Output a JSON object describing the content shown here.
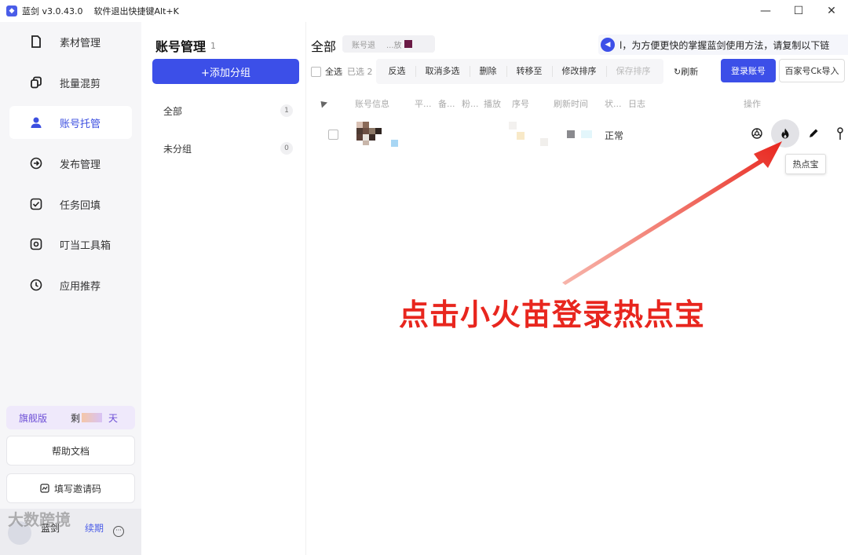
{
  "app": {
    "name": "蓝剑 v3.0.43.0",
    "shortcut": "软件退出快捷键Alt+K",
    "icon": "app-logo-icon"
  },
  "window": {
    "minimize": "—",
    "maximize": "☐",
    "close": "✕"
  },
  "sidebar": {
    "items": [
      {
        "label": "素材管理",
        "icon": "document-icon"
      },
      {
        "label": "批量混剪",
        "icon": "copy-icon"
      },
      {
        "label": "账号托管",
        "icon": "user-icon",
        "active": true
      },
      {
        "label": "发布管理",
        "icon": "publish-icon"
      },
      {
        "label": "任务回填",
        "icon": "task-check-icon"
      },
      {
        "label": "叮当工具箱",
        "icon": "toolbox-icon"
      },
      {
        "label": "应用推荐",
        "icon": "recommend-icon"
      }
    ],
    "vip": {
      "name": "旗舰版",
      "remain_prefix": "剩",
      "unit": "天"
    },
    "help": "帮助文档",
    "invite": "填写邀请码",
    "footer": {
      "name": "蓝剑",
      "link": "续期"
    }
  },
  "group_panel": {
    "title": "账号管理",
    "count": "1",
    "add_button": "+添加分组",
    "groups": [
      {
        "label": "全部",
        "count": "1"
      },
      {
        "label": "未分组",
        "count": "0"
      }
    ]
  },
  "main": {
    "title": "全部",
    "search_text": "账号退",
    "search_text_2": "...放",
    "notice": "l，为方便更快的掌握蓝剑使用方法，请复制以下链",
    "toolbar": {
      "select_all": "全选",
      "selected": "已选 2",
      "buttons": [
        "反选",
        "取消多选",
        "删除",
        "转移至",
        "修改排序",
        "保存排序"
      ],
      "refresh": "刷新",
      "login": "登录账号",
      "import": "百家号Ck导入"
    },
    "columns": [
      "账号信息",
      "平...",
      "备...",
      "粉...",
      "播放",
      "序号",
      "刷新时间",
      "状...",
      "日志",
      "操作"
    ],
    "row": {
      "status": "正常"
    },
    "tooltip": "热点宝"
  },
  "annotation": "点击小火苗登录热点宝",
  "watermark": "大数跨境",
  "colors": {
    "accent": "#3c4fe8",
    "annotation_red": "#e8261e",
    "vip_purple": "#6d4fd6"
  }
}
